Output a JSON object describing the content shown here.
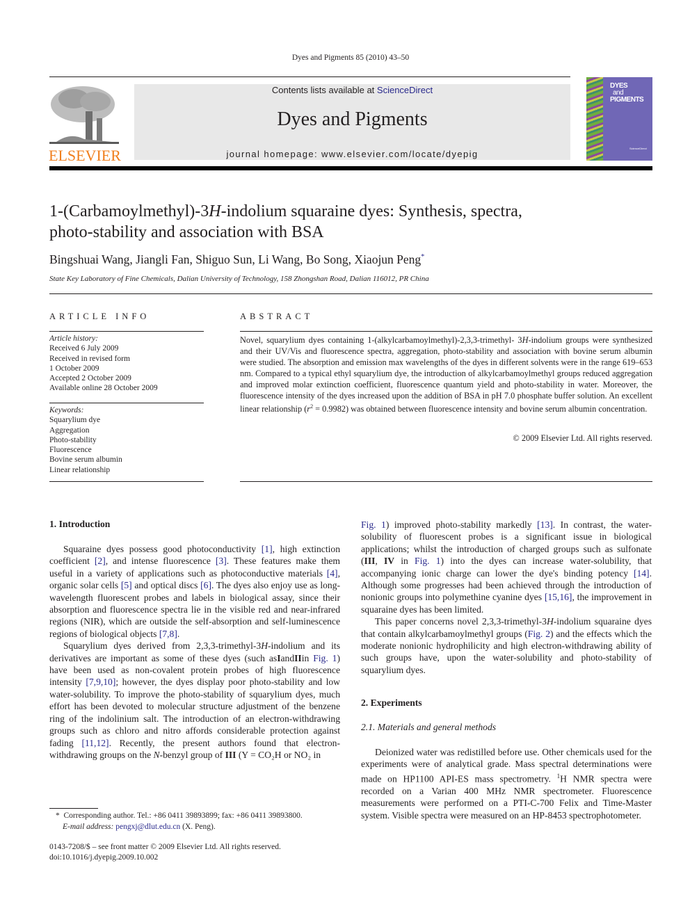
{
  "running_head": "Dyes and Pigments 85 (2010) 43–50",
  "masthead": {
    "contents_prefix": "Contents lists available at ",
    "contents_link": "ScienceDirect",
    "journal_name": "Dyes and Pigments",
    "homepage": "journal homepage: www.elsevier.com/locate/dyepig",
    "publisher_logo_text": "ELSEVIER",
    "cover_title_lines": [
      "DYES",
      "and",
      "PIGMENTS"
    ],
    "cover_footer": "ScienceDirect",
    "colors": {
      "masthead_bg": "#e8e8e8",
      "elsevier_orange": "#f07f1e",
      "cover_bg": "#7067b6",
      "link": "#2a2a8c"
    }
  },
  "article": {
    "title": "1-(Carbamoylmethyl)-3H-indolium squaraine dyes: Synthesis, spectra, photo-stability and association with BSA",
    "title_parts": [
      "1-(Carbamoylmethyl)-3",
      "H",
      "-indolium squaraine dyes: Synthesis, spectra,",
      "photo-stability and association with BSA"
    ],
    "authors": "Bingshuai Wang, Jiangli Fan, Shiguo Sun, Li Wang, Bo Song, Xiaojun Peng",
    "corresponding_mark": "*",
    "affiliation": "State Key Laboratory of Fine Chemicals, Dalian University of Technology, 158 Zhongshan Road, Dalian 116012, PR China"
  },
  "article_info": {
    "heading": "ARTICLE INFO",
    "history_label": "Article history:",
    "history": [
      "Received 6 July 2009",
      "Received in revised form",
      "1 October 2009",
      "Accepted 2 October 2009",
      "Available online 28 October 2009"
    ],
    "keywords_label": "Keywords:",
    "keywords": [
      "Squarylium dye",
      "Aggregation",
      "Photo-stability",
      "Fluorescence",
      "Bovine serum albumin",
      "Linear relationship"
    ]
  },
  "abstract": {
    "heading": "ABSTRACT",
    "text_1": "Novel, squarylium dyes containing 1-(alkylcarbamoylmethyl)-2,3,3-trimethyl- 3",
    "text_2": "-indolium groups were synthesized and their UV/Vis and fluorescence spectra, aggregation, photo-stability and association with bovine serum albumin were studied. The absorption and emission max wavelengths of the dyes in different solvents were in the range 619–653 nm. Compared to a typical ethyl squarylium dye, the introduction of alkylcarbamoylmethyl groups reduced aggregation and improved molar extinction coefficient, fluorescence quantum yield and photo-stability in water. Moreover, the fluorescence intensity of the dyes increased upon the addition of BSA in pH 7.0 phosphate buffer solution. An excellent linear relationship (",
    "r_squared": "r",
    "text_3": " = 0.9982) was obtained between fluorescence intensity and bovine serum albumin concentration.",
    "copyright": "© 2009 Elsevier Ltd. All rights reserved."
  },
  "body": {
    "intro_heading": "1.  Introduction",
    "p1": [
      {
        "t": "Squaraine dyes possess good photoconductivity "
      },
      {
        "l": "[1]"
      },
      {
        "t": ", high extinction coefficient "
      },
      {
        "l": "[2]"
      },
      {
        "t": ", and intense fluorescence "
      },
      {
        "l": "[3]"
      },
      {
        "t": ". These features make them useful in a variety of applications such as photoconductive materials "
      },
      {
        "l": "[4]"
      },
      {
        "t": ", organic solar cells "
      },
      {
        "l": "[5]"
      },
      {
        "t": " and optical discs "
      },
      {
        "l": "[6]"
      },
      {
        "t": ". The dyes also enjoy use as long-wavelength fluorescent probes and labels in biological assay, since their absorption and fluorescence spectra lie in the visible red and near-infrared regions (NIR), which are outside the self-absorption and self-luminescence regions of biological objects "
      },
      {
        "l": "[7,8]"
      },
      {
        "t": "."
      }
    ],
    "p2": [
      {
        "t": "Squarylium dyes derived from 2,3,3-trimethyl-3"
      },
      {
        "i": "H"
      },
      {
        "t": "-indolium and its derivatives are important as some of these dyes (such as"
      },
      {
        "b": "I"
      },
      {
        "t": "and"
      },
      {
        "b": "II"
      },
      {
        "t": "in "
      },
      {
        "l": "Fig. 1"
      },
      {
        "t": ") have been used as non-covalent protein probes of high fluorescence intensity "
      },
      {
        "l": "[7,9,10]"
      },
      {
        "t": "; however, the dyes display poor photo-stability and low water-solubility. To improve the photo-stability of squarylium dyes, much effort has been devoted to molecular structure adjustment of the benzene ring of the indolinium salt. The introduction of an electron-withdrawing groups such as chloro and nitro affords considerable protection against fading "
      },
      {
        "l": "[11,12]"
      },
      {
        "t": ". Recently, the present authors found that electron-withdrawing groups on the "
      },
      {
        "i": "N"
      },
      {
        "t": "-benzyl group of "
      },
      {
        "b": "III"
      },
      {
        "t": " (Y = CO₂H or NO₂ in"
      }
    ],
    "p3": [
      {
        "l": "Fig. 1"
      },
      {
        "t": ") improved photo-stability markedly "
      },
      {
        "l": "[13]"
      },
      {
        "t": ". In contrast, the water-solubility of fluorescent probes is a significant issue in biological applications; whilst the introduction of charged groups such as sulfonate ("
      },
      {
        "b": "III"
      },
      {
        "t": ", "
      },
      {
        "b": "IV"
      },
      {
        "t": " in "
      },
      {
        "l": "Fig. 1"
      },
      {
        "t": ") into the dyes can increase water-solubility, that accompanying ionic charge can lower the dye's binding potency "
      },
      {
        "l": "[14]"
      },
      {
        "t": ". Although some progresses had been achieved through the introduction of nonionic groups into polymethine cyanine dyes "
      },
      {
        "l": "[15,16]"
      },
      {
        "t": ", the improvement in squaraine dyes has been limited."
      }
    ],
    "p4": [
      {
        "t": "This paper concerns novel 2,3,3-trimethyl-3"
      },
      {
        "i": "H"
      },
      {
        "t": "-indolium squaraine dyes that contain alkylcarbamoylmethyl groups ("
      },
      {
        "l": "Fig. 2"
      },
      {
        "t": ") and the effects which the moderate nonionic hydrophilicity and high electron-withdrawing ability of such groups have, upon the water-solubility and photo-stability of squarylium dyes."
      }
    ],
    "exp_heading": "2.  Experiments",
    "sub21_heading": "2.1.  Materials and general methods",
    "p5": [
      {
        "t": "Deionized water was redistilled before use. Other chemicals used for the experiments were of analytical grade. Mass spectral determinations were made on HP1100 API-ES mass spectrometry. "
      },
      {
        "s": "1"
      },
      {
        "t": "H NMR spectra were recorded on a Varian 400 MHz NMR spectrometer. Fluorescence measurements were performed on a PTI-C-700 Felix and Time-Master system. Visible spectra were measured on an HP-8453 spectrophotometer."
      }
    ]
  },
  "footnote": {
    "mark": "*",
    "contact": "Corresponding author. Tel.: +86 0411 39893899; fax: +86 0411 39893800.",
    "email_label": "E-mail address:",
    "email": "pengxj@dlut.edu.cn",
    "email_suffix": "(X. Peng)."
  },
  "front_matter": {
    "issn_line": "0143-7208/$ – see front matter © 2009 Elsevier Ltd. All rights reserved.",
    "doi": "doi:10.1016/j.dyepig.2009.10.002"
  }
}
